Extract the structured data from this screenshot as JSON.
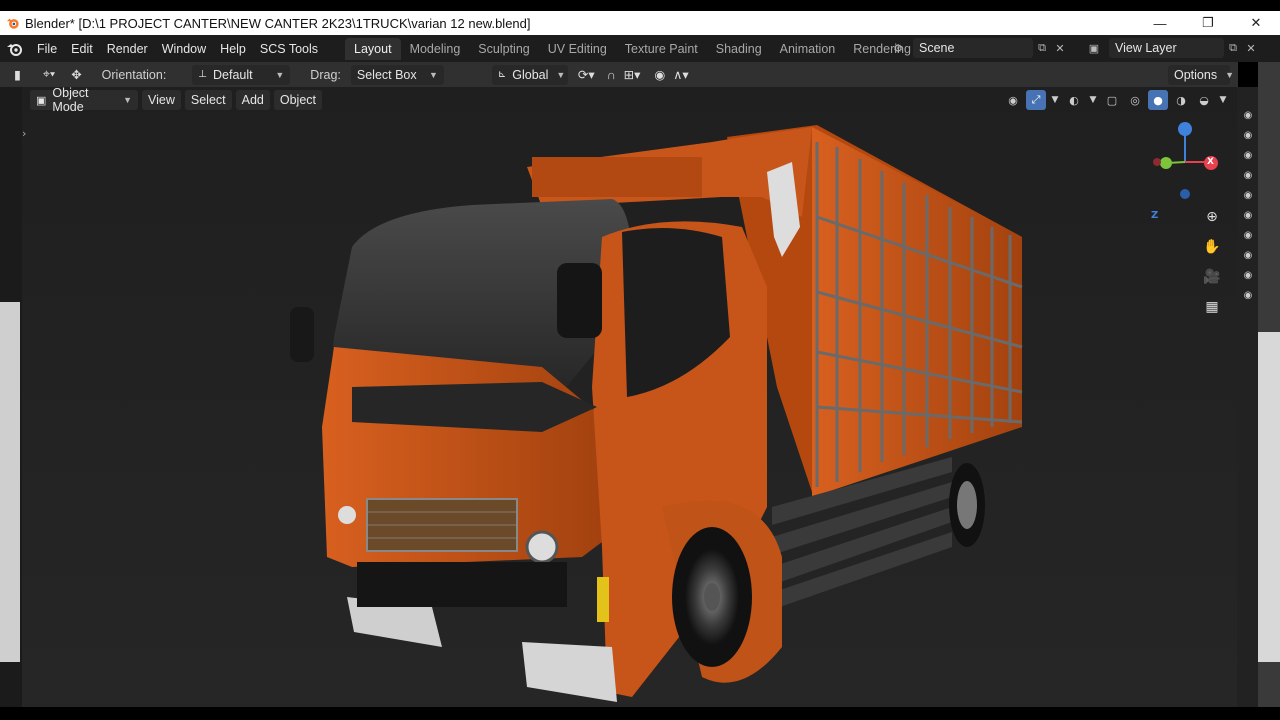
{
  "window": {
    "title": "Blender* [D:\\1 PROJECT CANTER\\NEW CANTER 2K23\\1TRUCK\\varian 12 new.blend]",
    "minimize": "—",
    "maximize": "❐",
    "close": "✕"
  },
  "menu": {
    "items": [
      "File",
      "Edit",
      "Render",
      "Window",
      "Help",
      "SCS Tools"
    ]
  },
  "workspaces": {
    "tabs": [
      "Layout",
      "Modeling",
      "Sculpting",
      "UV Editing",
      "Texture Paint",
      "Shading",
      "Animation",
      "Rendering"
    ],
    "active": "Layout"
  },
  "scene": {
    "value": "Scene"
  },
  "view_layer": {
    "value": "View Layer"
  },
  "toolbar": {
    "orientation_label": "Orientation:",
    "orientation_value": "Default",
    "drag_label": "Drag:",
    "drag_value": "Select Box",
    "transform_value": "Global",
    "options_label": "Options"
  },
  "viewport_header": {
    "mode": "Object Mode",
    "view": "View",
    "select": "Select",
    "add": "Add",
    "object": "Object"
  },
  "gizmo": {
    "z": "Z",
    "x": "X"
  },
  "colors": {
    "truck_orange": "#c4501a",
    "accent_blue": "#4772b3",
    "axis_x": "#e8404e",
    "axis_y": "#7cc43a",
    "axis_z": "#3f82dc"
  }
}
